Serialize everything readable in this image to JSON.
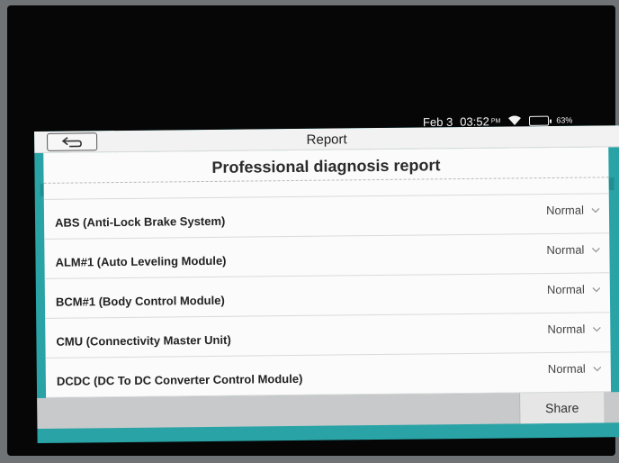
{
  "status_bar": {
    "date": "Feb 3",
    "time": "03:52",
    "ampm": "PM",
    "battery_percent": "63%",
    "battery_level": 0.63
  },
  "header": {
    "back_icon": "back-arrow-icon",
    "title": "Report"
  },
  "report": {
    "heading": "Professional diagnosis report",
    "rows": [
      {
        "name": "ABS (Anti-Lock Brake System)",
        "status": "Normal"
      },
      {
        "name": "ALM#1 (Auto Leveling Module)",
        "status": "Normal"
      },
      {
        "name": "BCM#1 (Body Control Module)",
        "status": "Normal"
      },
      {
        "name": "CMU (Connectivity Master Unit)",
        "status": "Normal"
      },
      {
        "name": "DCDC (DC To DC Converter Control Module)",
        "status": "Normal"
      }
    ]
  },
  "footer": {
    "share_label": "Share"
  },
  "colors": {
    "accent": "#2aa3a6",
    "battery": "#3bd14a"
  }
}
